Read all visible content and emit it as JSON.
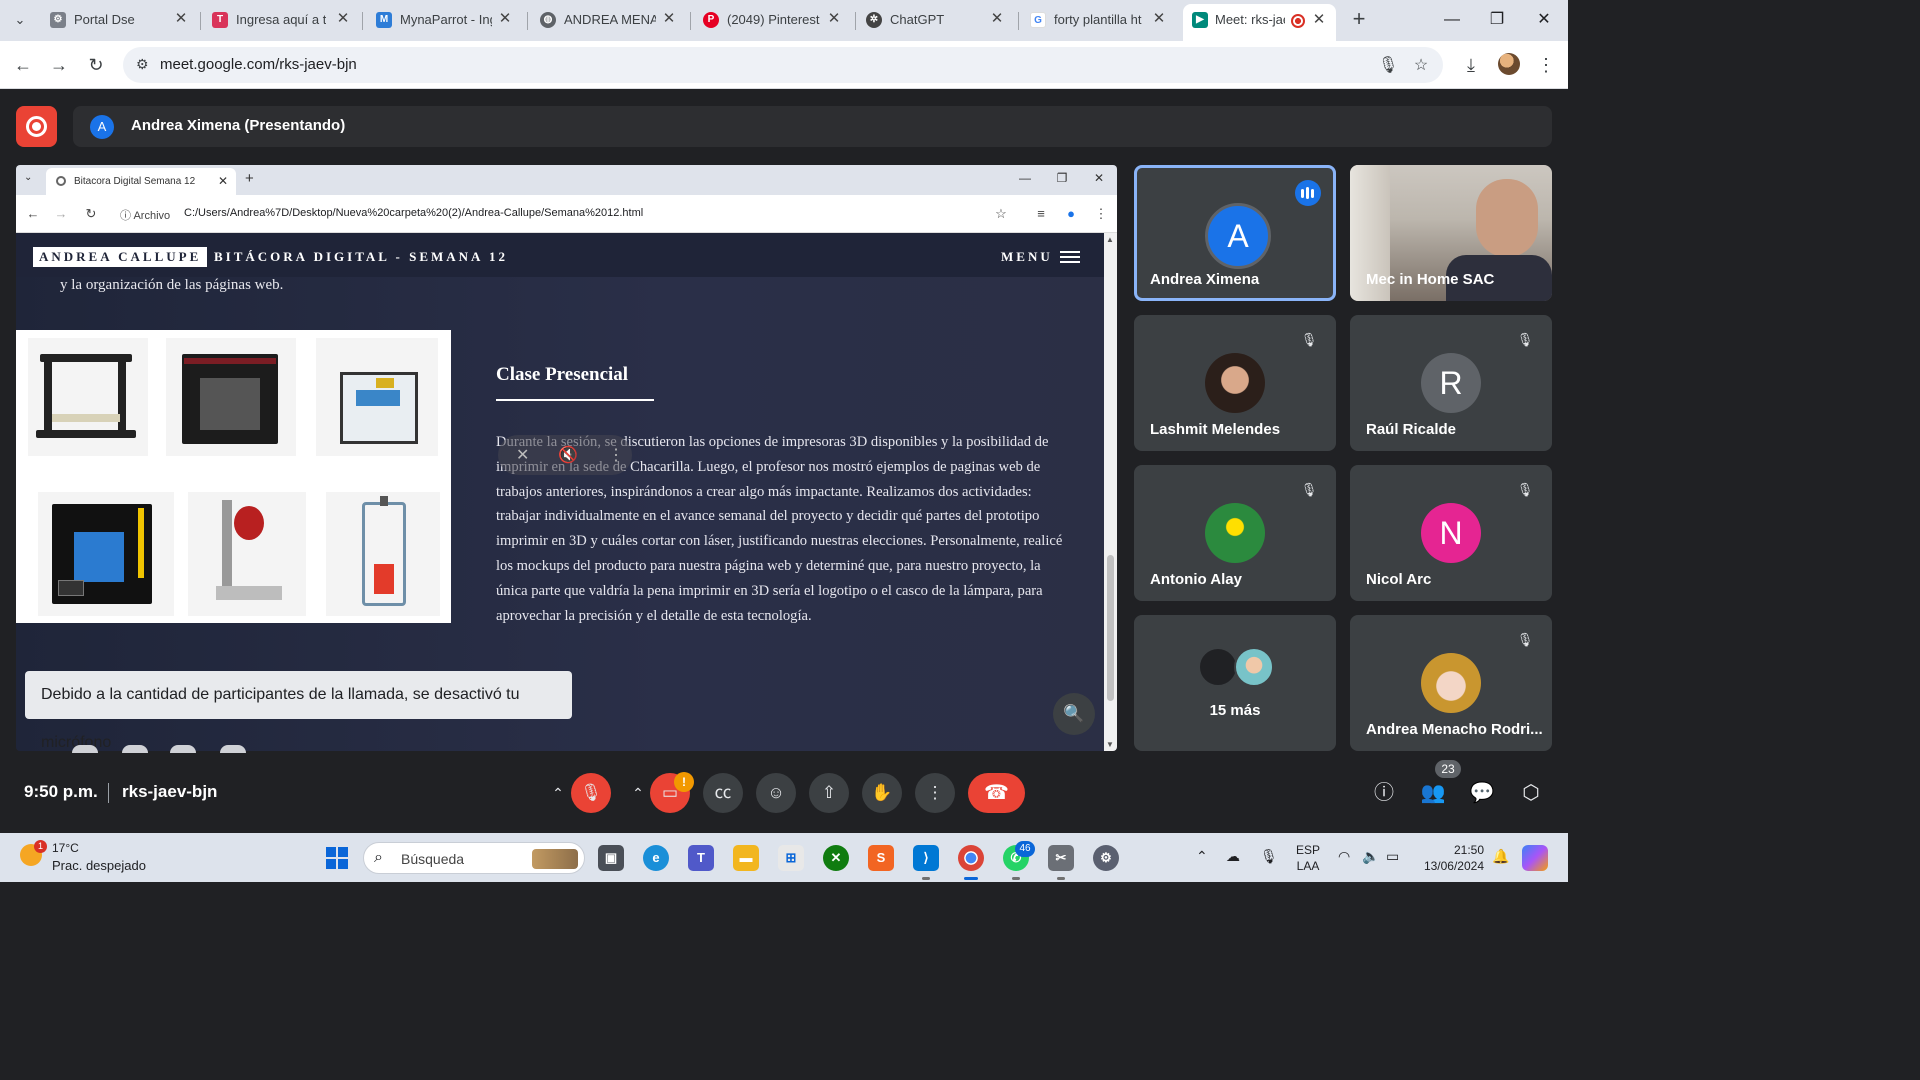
{
  "browser": {
    "tabs": [
      {
        "title": "Portal Dse",
        "icon": "gear-favicon",
        "color": "#7b8089"
      },
      {
        "title": "Ingresa aquí a tu",
        "icon": "tls-favicon",
        "color": "#d9345a"
      },
      {
        "title": "MynaParrot - Ing",
        "icon": "mynaparrot-favicon",
        "color": "#2e7dd7"
      },
      {
        "title": "ANDREA MENAC",
        "icon": "globe-favicon",
        "color": "#5f6368"
      },
      {
        "title": "(2049) Pinterest",
        "icon": "pinterest-favicon",
        "color": "#e60023"
      },
      {
        "title": "ChatGPT",
        "icon": "chatgpt-favicon",
        "color": "#444444"
      },
      {
        "title": "forty plantilla htr",
        "icon": "google-favicon",
        "color": "#4285f4"
      },
      {
        "title": "Meet: rks-jae",
        "icon": "meet-favicon",
        "color": "#00897b"
      }
    ],
    "url": "meet.google.com/rks-jaev-bjn"
  },
  "meet": {
    "presenter_initial": "A",
    "presenter_label": "Andrea Ximena (Presentando)",
    "time": "9:50 p.m.",
    "meeting_code": "rks-jaev-bjn",
    "participant_count": "23",
    "warning_badge": "!",
    "toast": "Debido a la cantidad de participantes de la llamada, se desactivó tu micrófono",
    "participants": [
      {
        "name": "Andrea Ximena",
        "initial": "A",
        "color": "#1a73e8",
        "speaking": true
      },
      {
        "name": "Mec in Home SAC",
        "initial": "",
        "color": "",
        "speaking": false
      },
      {
        "name": "Lashmit Melendes",
        "initial": "",
        "color": "",
        "speaking": false
      },
      {
        "name": "Raúl Ricalde",
        "initial": "R",
        "color": "#5f6368",
        "speaking": false
      },
      {
        "name": "Antonio Alay",
        "initial": "",
        "color": "",
        "speaking": false
      },
      {
        "name": "Nicol Arc",
        "initial": "N",
        "color": "#e52592",
        "speaking": false
      },
      {
        "name": "15 más",
        "initial": "",
        "color": "",
        "speaking": false
      },
      {
        "name": "Andrea Menacho Rodri...",
        "initial": "",
        "color": "",
        "speaking": false
      }
    ]
  },
  "shared_screen": {
    "tab_title": "Bitacora Digital Semana 12",
    "archivo_label": "Archivo",
    "path": "C:/Users/Andrea%7D/Desktop/Nueva%20carpeta%20(2)/Andrea-Callupe/Semana%2012.html",
    "site_logo": "ANDREA CALLUPE",
    "site_title": "BITÁCORA DIGITAL - SEMANA 12",
    "menu_label": "MENU",
    "cut_text": "y la organización de las páginas web.",
    "section_title": "Clase Presencial",
    "paragraph": "Durante la sesión, se discutieron las opciones de impresoras 3D disponibles y la posibilidad de imprimir en la sede de Chacarilla. Luego, el profesor nos mostró ejemplos de paginas web de trabajos anteriores, inspirándonos a crear algo más impactante. Realizamos dos actividades: trabajar individualmente en el avance semanal del proyecto y decidir qué partes del prototipo imprimir en 3D y cuáles cortar con láser, justificando nuestras elecciones. Personalmente, realicé los mockups del producto para nuestra página web y determiné que, para nuestro proyecto, la única parte que valdría la pena imprimir en 3D sería el logotipo o el casco de la lámpara, para aprovechar la precisión y el detalle de esta tecnología."
  },
  "taskbar": {
    "temperature": "17°C",
    "condition": "Prac. despejado",
    "weather_badge": "1",
    "search_placeholder": "Búsqueda",
    "whatsapp_badge": "46",
    "lang_top": "ESP",
    "lang_bottom": "LAA",
    "clock_time": "21:50",
    "clock_date": "13/06/2024"
  }
}
